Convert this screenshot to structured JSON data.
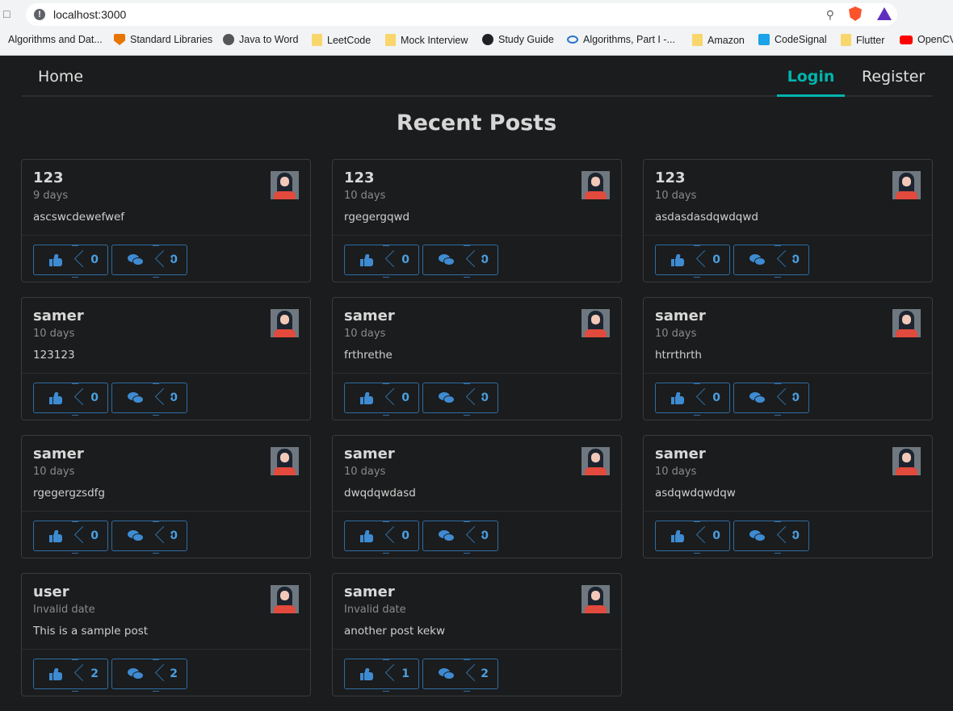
{
  "browser": {
    "url": "localhost:3000",
    "bookmarks": [
      {
        "label": "Algorithms and Dat...",
        "icon": "folder-icon"
      },
      {
        "label": "Standard Libraries",
        "icon": "princeton-icon"
      },
      {
        "label": "Java to Word",
        "icon": "globe-icon"
      },
      {
        "label": "LeetCode",
        "icon": "folder-icon"
      },
      {
        "label": "Mock Interview",
        "icon": "folder-icon"
      },
      {
        "label": "Study Guide",
        "icon": "github-icon"
      },
      {
        "label": "Algorithms, Part I -...",
        "icon": "coursera-icon"
      },
      {
        "label": "Amazon",
        "icon": "folder-icon"
      },
      {
        "label": "CodeSignal",
        "icon": "codesignal-icon"
      },
      {
        "label": "Flutter",
        "icon": "folder-icon"
      },
      {
        "label": "OpenCV",
        "icon": "youtube-icon"
      }
    ]
  },
  "nav": {
    "home": "Home",
    "login": "Login",
    "register": "Register"
  },
  "page": {
    "title": "Recent Posts"
  },
  "posts": [
    {
      "author": "123",
      "date": "9 days",
      "body": "ascswcdewefwef",
      "likes": "0",
      "comments": "0"
    },
    {
      "author": "123",
      "date": "10 days",
      "body": "rgegergqwd",
      "likes": "0",
      "comments": "0"
    },
    {
      "author": "123",
      "date": "10 days",
      "body": "asdasdasdqwdqwd",
      "likes": "0",
      "comments": "0"
    },
    {
      "author": "samer",
      "date": "10 days",
      "body": "123123",
      "likes": "0",
      "comments": "0"
    },
    {
      "author": "samer",
      "date": "10 days",
      "body": "frthrethe",
      "likes": "0",
      "comments": "0"
    },
    {
      "author": "samer",
      "date": "10 days",
      "body": "htrrthrth",
      "likes": "0",
      "comments": "0"
    },
    {
      "author": "samer",
      "date": "10 days",
      "body": "rgegergzsdfg",
      "likes": "0",
      "comments": "0"
    },
    {
      "author": "samer",
      "date": "10 days",
      "body": "dwqdqwdasd",
      "likes": "0",
      "comments": "0"
    },
    {
      "author": "samer",
      "date": "10 days",
      "body": "asdqwdqwdqw",
      "likes": "0",
      "comments": "0"
    },
    {
      "author": "user",
      "date": "Invalid date",
      "body": "This is a sample post",
      "likes": "2",
      "comments": "2"
    },
    {
      "author": "samer",
      "date": "Invalid date",
      "body": "another post kekw",
      "likes": "1",
      "comments": "2"
    }
  ],
  "colors": {
    "background": "#1b1c1d",
    "accent": "#00b5ad",
    "button": "#2e6da4"
  }
}
